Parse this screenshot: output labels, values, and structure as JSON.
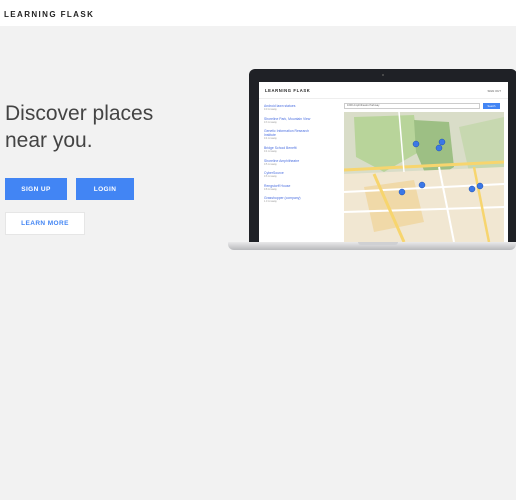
{
  "header": {
    "brand": "LEARNING FLASK"
  },
  "hero": {
    "headline_line1": "Discover places",
    "headline_line2": "near you.",
    "signup_label": "SIGN UP",
    "login_label": "LOGIN",
    "learn_more_label": "LEARN MORE"
  },
  "colors": {
    "accent": "#4285f4",
    "background": "#f2f2f2"
  },
  "laptop_screen": {
    "brand": "LEARNING FLASK",
    "signout": "SIGN OUT",
    "search_value": "1600 Amphitheatre Parkway",
    "search_button": "Search",
    "places": [
      {
        "title": "Android lawn statues",
        "sub": "0.0 mi away"
      },
      {
        "title": "Shoreline Park, Mountain View",
        "sub": "0.3 mi away"
      },
      {
        "title": "Genetic Information Research",
        "title2": "Institute",
        "sub": "0.4 mi away"
      },
      {
        "title": "Bridge School Benefit",
        "sub": "0.4 mi away"
      },
      {
        "title": "Shoreline Amphitheatre",
        "sub": "0.5 mi away"
      },
      {
        "title": "CyberSource",
        "sub": "0.6 mi away"
      },
      {
        "title": "Rengstorff House",
        "sub": "0.8 mi away"
      },
      {
        "title": "Grasshopper (company)",
        "sub": "1.0 mi away"
      }
    ]
  }
}
